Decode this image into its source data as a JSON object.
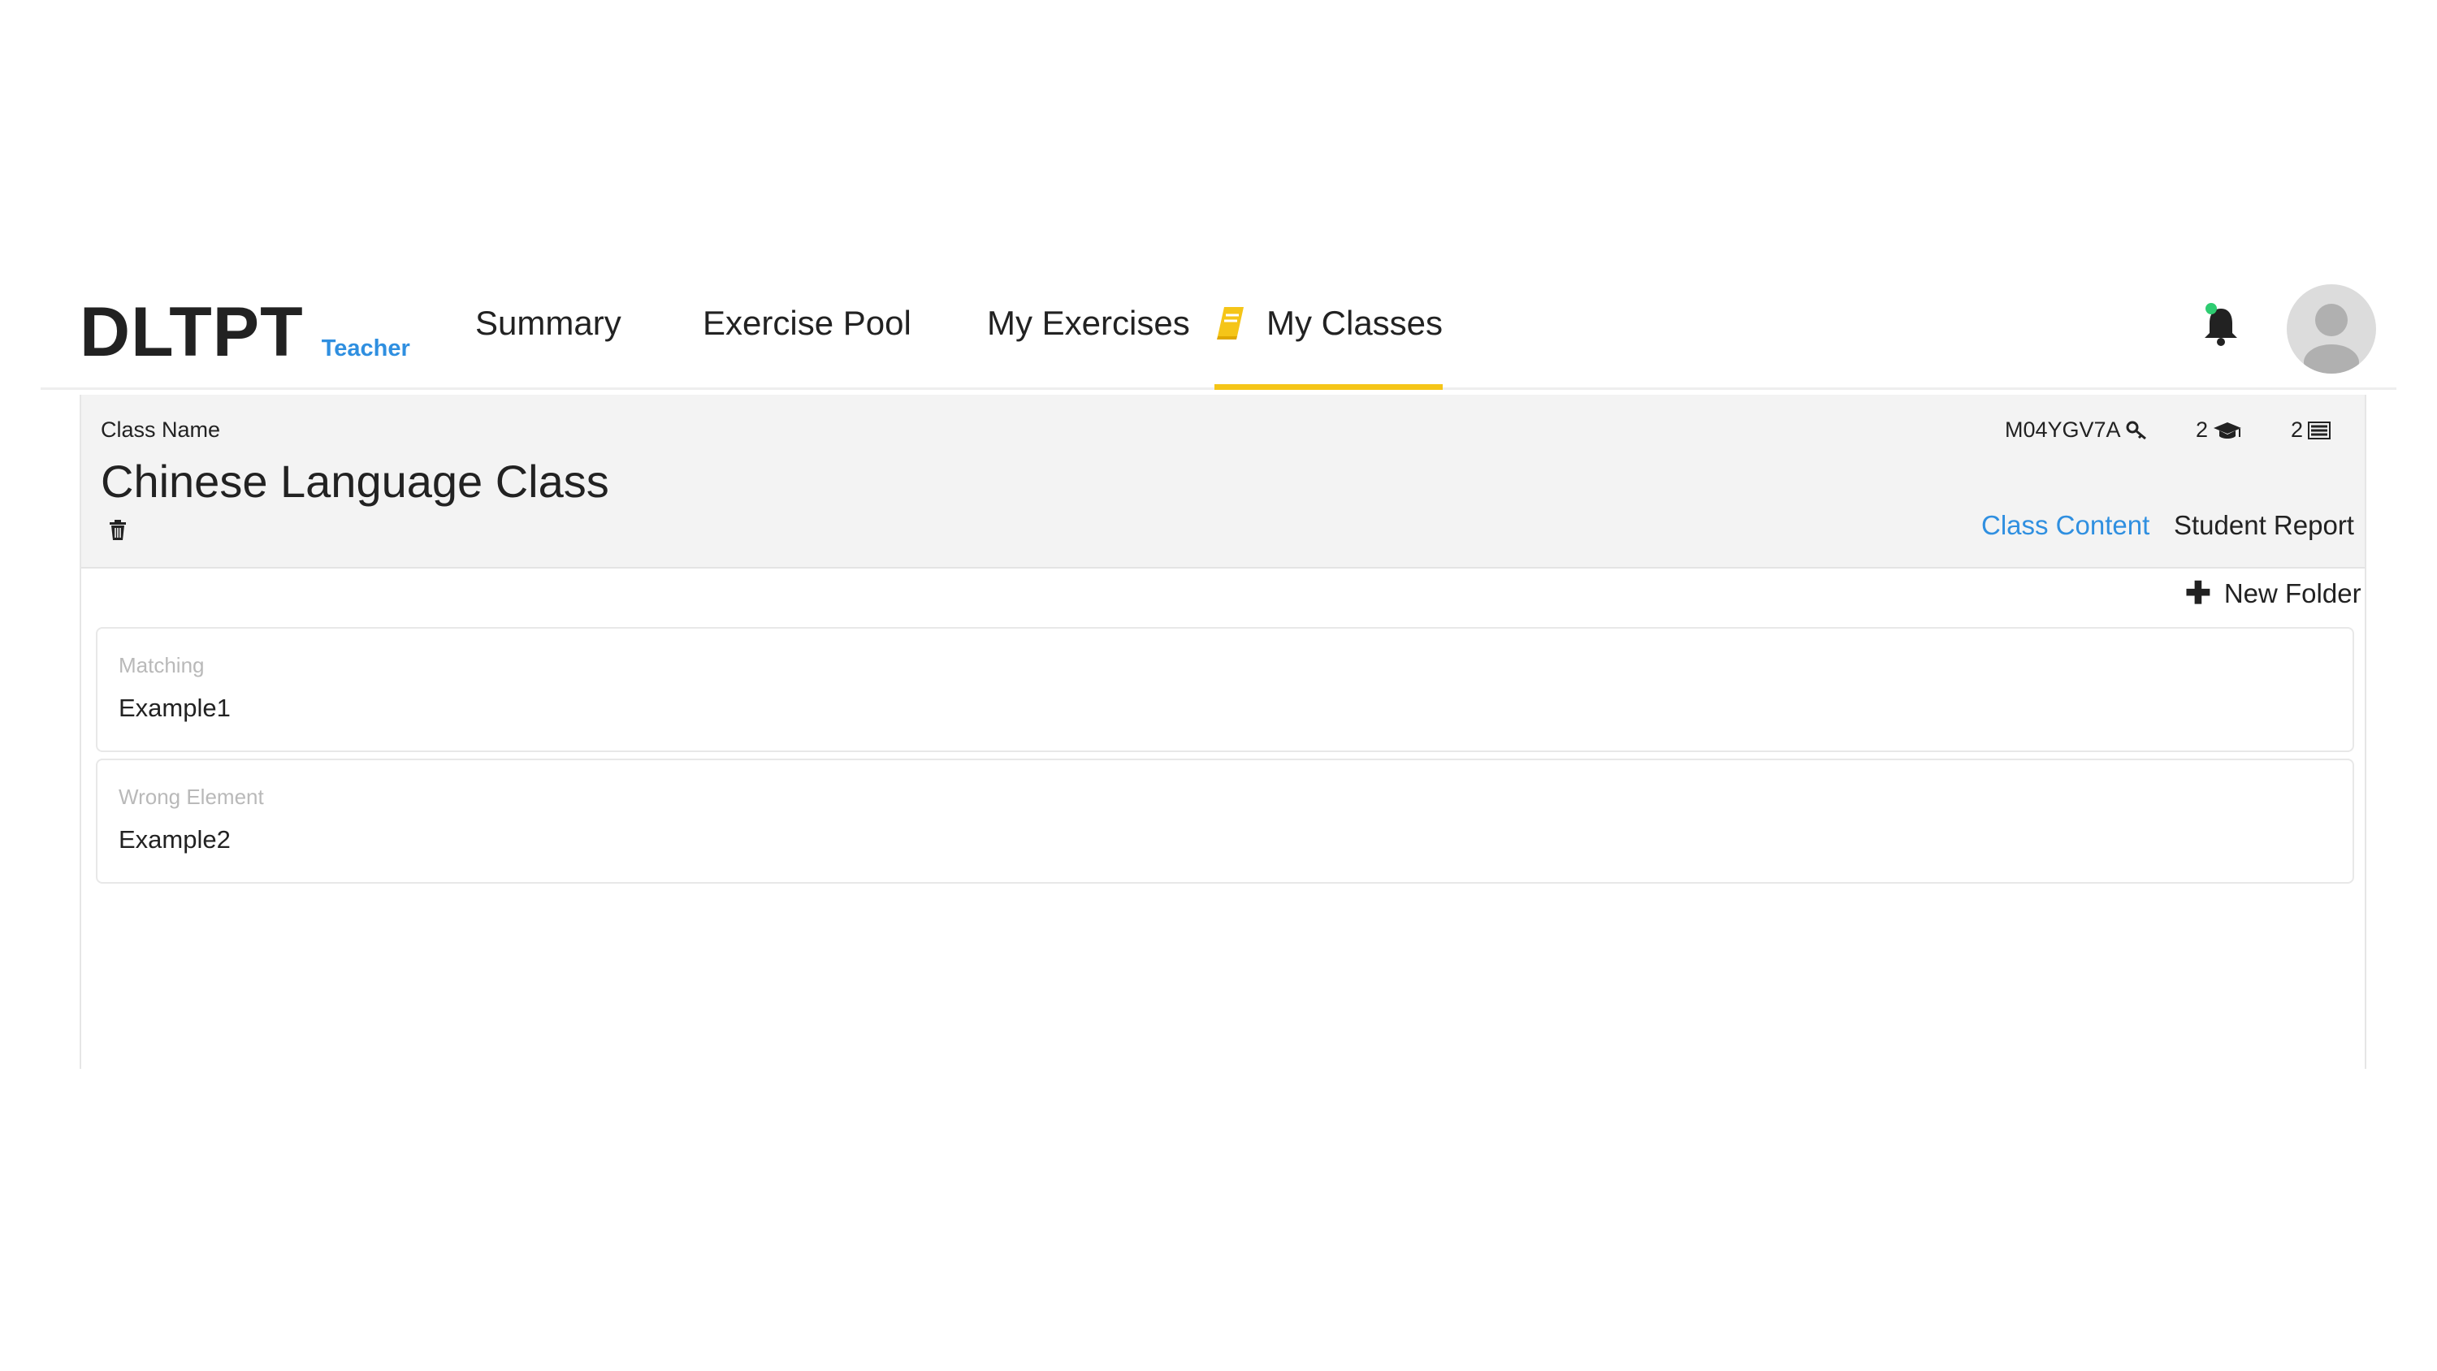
{
  "brand": {
    "logo": "DLTPT",
    "role": "Teacher"
  },
  "nav": {
    "summary": "Summary",
    "exercise_pool": "Exercise Pool",
    "my_exercises": "My Exercises",
    "my_classes": "My Classes",
    "active": "My Classes"
  },
  "header_icons": {
    "notifications": "bell-icon",
    "notification_dot_color": "#2ecc71",
    "avatar": "user-avatar"
  },
  "class": {
    "label": "Class Name",
    "name": "Chinese Language Class",
    "code": "M04YGV7A",
    "student_count": "2",
    "exercise_count": "2"
  },
  "tabs": {
    "content": "Class Content",
    "report": "Student Report",
    "active": "Class Content"
  },
  "actions": {
    "new_folder": "New Folder"
  },
  "folders": [
    {
      "type": "Matching",
      "name": "Example1"
    },
    {
      "type": "Wrong Element",
      "name": "Example2"
    }
  ],
  "colors": {
    "accent_blue": "#2f8fe0",
    "active_underline": "#f5c518",
    "header_bg": "#f3f3f3"
  }
}
